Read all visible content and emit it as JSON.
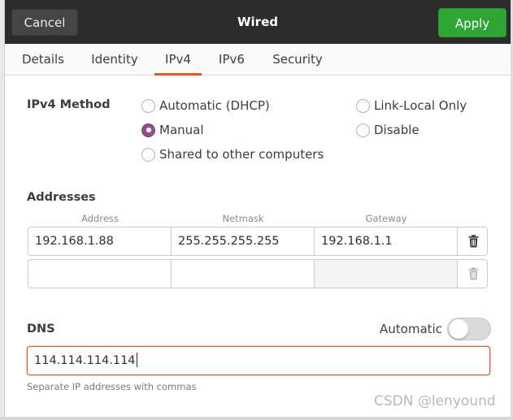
{
  "window": {
    "title": "Wired",
    "cancel_label": "Cancel",
    "apply_label": "Apply"
  },
  "tabs": [
    {
      "label": "Details",
      "active": false
    },
    {
      "label": "Identity",
      "active": false
    },
    {
      "label": "IPv4",
      "active": true
    },
    {
      "label": "IPv6",
      "active": false
    },
    {
      "label": "Security",
      "active": false
    }
  ],
  "ipv4_method": {
    "label": "IPv4 Method",
    "options": [
      {
        "label": "Automatic (DHCP)",
        "checked": false
      },
      {
        "label": "Link-Local Only",
        "checked": false
      },
      {
        "label": "Manual",
        "checked": true
      },
      {
        "label": "Disable",
        "checked": false
      },
      {
        "label": "Shared to other computers",
        "checked": false
      }
    ]
  },
  "addresses": {
    "label": "Addresses",
    "columns": [
      "Address",
      "Netmask",
      "Gateway"
    ],
    "rows": [
      {
        "address": "192.168.1.88",
        "netmask": "255.255.255.255",
        "gateway": "192.168.1.1"
      },
      {
        "address": "",
        "netmask": "",
        "gateway": ""
      }
    ]
  },
  "dns": {
    "label": "DNS",
    "automatic_label": "Automatic",
    "automatic_on": false,
    "value": "114.114.114.114",
    "hint": "Separate IP addresses with commas"
  },
  "watermark": "CSDN @lenyound",
  "colors": {
    "accent": "#e95420",
    "apply_green": "#2fa634",
    "radio_checked": "#924d8b",
    "titlebar": "#2c2c2c"
  },
  "icons": {
    "delete": "trash-icon"
  }
}
